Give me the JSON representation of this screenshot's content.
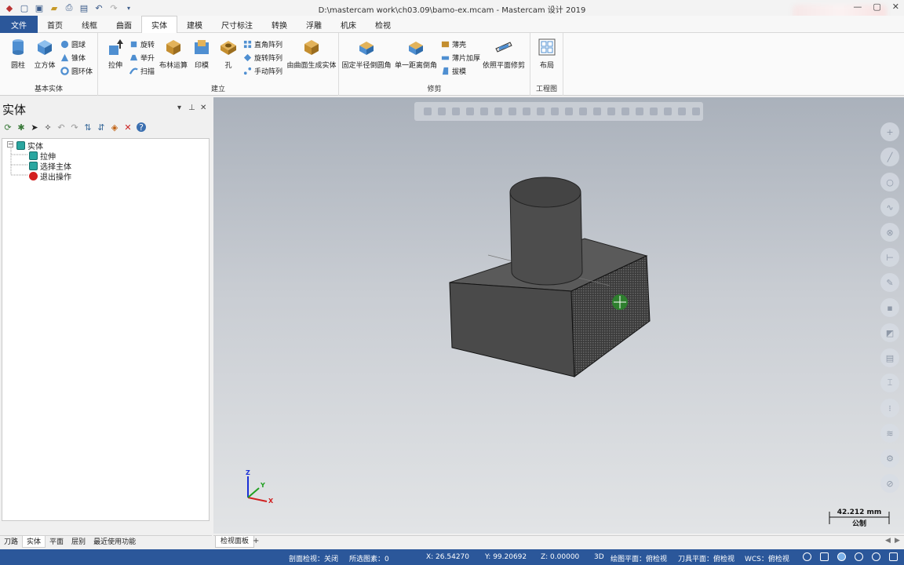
{
  "window": {
    "title": "D:\\mastercam work\\ch03.09\\bamo-ex.mcam - Mastercam 设计 2019"
  },
  "tabs": [
    {
      "label": "文件"
    },
    {
      "label": "首页"
    },
    {
      "label": "线框"
    },
    {
      "label": "曲面"
    },
    {
      "label": "实体"
    },
    {
      "label": "建模"
    },
    {
      "label": "尺寸标注"
    },
    {
      "label": "转换"
    },
    {
      "label": "浮雕"
    },
    {
      "label": "机床"
    },
    {
      "label": "检视"
    }
  ],
  "ribbon": {
    "basic": {
      "label": "基本实体",
      "cylinder": "圆柱",
      "cube": "立方体",
      "sphere": "圆球",
      "cone": "锥体",
      "torus": "圆环体"
    },
    "create": {
      "label": "建立",
      "extrude": "拉伸",
      "revolve": "旋转",
      "loft": "举升",
      "sweep": "扫描",
      "boolean": "布林运算",
      "impression": "印模",
      "hole": "孔",
      "rect_pattern": "直角阵列",
      "rot_pattern": "旋转阵列",
      "man_pattern": "手动阵列",
      "from_surface": "由曲面生成实体"
    },
    "modify": {
      "label": "修剪",
      "const_fillet": "固定半径倒圆角",
      "chamfer": "单一距离倒角",
      "shell": "薄壳",
      "thicken": "薄片加厚",
      "draft": "拔模",
      "trim_plane": "依照平面修剪"
    },
    "drawing": {
      "label": "工程图",
      "layout": "布局"
    }
  },
  "panel": {
    "title": "实体",
    "tree": [
      {
        "label": "实体"
      },
      {
        "label": "拉伸"
      },
      {
        "label": "选择主体"
      },
      {
        "label": "退出操作"
      }
    ],
    "bottom_tabs": [
      {
        "label": "刀路"
      },
      {
        "label": "实体"
      },
      {
        "label": "平面"
      },
      {
        "label": "层别"
      },
      {
        "label": "最近使用功能"
      }
    ]
  },
  "viewport": {
    "scale_value": "42.212 mm",
    "scale_unit": "公制",
    "axis": {
      "z": "Z",
      "y": "Y",
      "x": "X"
    }
  },
  "viewsheet": {
    "tab": "检视面板",
    "add": "+"
  },
  "status": {
    "section_view": "剖面检视：关闭",
    "selected": "所选图素：0",
    "x": "X:  26.54270",
    "y": "Y:  99.20692",
    "z": "Z:  0.00000",
    "mode": "3D",
    "draw_plane": "绘图平面：俯检视",
    "tool_plane": "刀具平面：俯检视",
    "wcs": "WCS：俯检视"
  },
  "colors": {
    "accent": "#2b579a",
    "model": "#4a4a4a"
  }
}
